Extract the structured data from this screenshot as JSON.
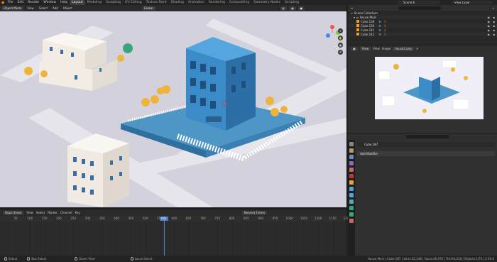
{
  "topbar": {
    "menus": [
      "File",
      "Edit",
      "Render",
      "Window",
      "Help"
    ],
    "workspaces": [
      "Layout",
      "Modeling",
      "Sculpting",
      "UV Editing",
      "Texture Paint",
      "Shading",
      "Animation",
      "Rendering",
      "Compositing",
      "Geometry Nodes",
      "Scripting"
    ],
    "active_workspace": "Layout",
    "scene": "Scene 6",
    "view_layer": "View Layer"
  },
  "viewport_header": {
    "mode": "Object Mode",
    "menus": [
      "View",
      "Select",
      "Add",
      "Object"
    ],
    "transform_orientation": "Global"
  },
  "dopesheet": {
    "mode": "Dope Sheet",
    "menus": [
      "View",
      "Select",
      "Marker",
      "Channel",
      "Key"
    ],
    "frame_option": "Nearest Frame",
    "current_frame": "601",
    "ticks": [
      "50",
      "100",
      "150",
      "200",
      "250",
      "300",
      "350",
      "400",
      "450",
      "500",
      "550",
      "600",
      "650",
      "700",
      "750",
      "800",
      "850",
      "900",
      "950",
      "1000",
      "1050",
      "1100",
      "1150",
      "1200"
    ]
  },
  "outliner": {
    "scene_collection": "Scene Collection",
    "house_collection": "House Main",
    "rows": [
      "Cube.138",
      "Cube.139",
      "Cube.141",
      "Cube.142"
    ]
  },
  "image_editor": {
    "menus": [
      "View",
      "View",
      "Image"
    ],
    "image_name": "house2.png"
  },
  "properties": {
    "object_name": "Cube.187",
    "add_modifier": "Add Modifier"
  },
  "statusbar": {
    "select": "Select",
    "box_select": "Box Select",
    "zoom_view": "Zoom View",
    "lasso_select": "Lasso Select",
    "stats": "House Main | Cube.187 | Verts:52,348 | Faces:49,070 | Tris:94,418 | Objects:1/73 | 2.93.0"
  },
  "colors": {
    "house_blue": "#3c8bc9",
    "garden_blue": "#4d96c6",
    "tree_yellow": "#f0b43c",
    "ground": "#d3d1dc",
    "accent": "#e87d0d"
  }
}
